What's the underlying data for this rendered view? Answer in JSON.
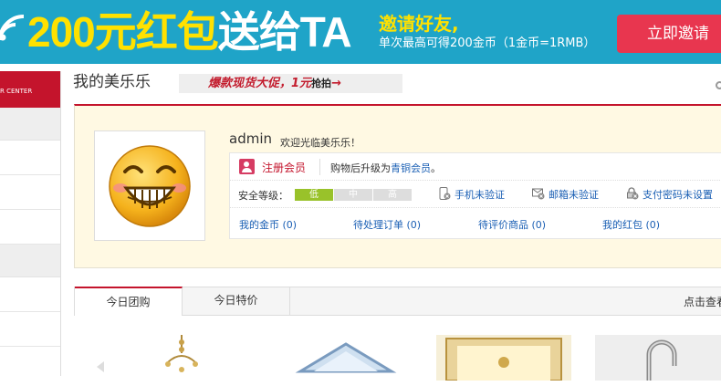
{
  "banner": {
    "amount": "200元",
    "gift": "红包",
    "sendto": "送给TA",
    "invite_friends": "邀请好友,",
    "reward_text": "单次最高可得200金币（1金币=1RMB）",
    "invite_button": "立即邀请"
  },
  "sidebar": {
    "header": "R CENTER"
  },
  "main": {
    "title": "我的美乐乐",
    "promo": "爆款现货大促，",
    "promo_price": "1元",
    "promo_action": "抢拍",
    "promo_arrow": "→"
  },
  "profile": {
    "username": "admin",
    "welcome": "欢迎光临美乐乐！",
    "register_label": "注册会员",
    "upgrade_prefix": "购物后升级为",
    "upgrade_level": "青铜会员",
    "upgrade_suffix": "。",
    "security_label": "安全等级：",
    "security_levels": [
      "低",
      "中",
      "高"
    ],
    "security_current": "低",
    "phone_status": "手机未验证",
    "email_status": "邮箱未验证",
    "paypwd_status": "支付密码未设置",
    "stats": [
      {
        "label": "我的金币",
        "count": "(0)"
      },
      {
        "label": "待处理订单",
        "count": "(0)"
      },
      {
        "label": "待评价商品",
        "count": "(0)"
      },
      {
        "label": "我的红包",
        "count": "(0)"
      }
    ]
  },
  "tabs": {
    "items": [
      "今日团购",
      "今日特价"
    ],
    "active": "今日团购",
    "more": "点击查看"
  },
  "icons": {
    "wifi": "wifi-icon",
    "avatar": "smiley-avatar",
    "register": "user-icon",
    "phone": "phone-icon",
    "email": "mail-icon",
    "paypwd": "lock-icon",
    "scroll": "scroll-knob-icon"
  },
  "colors": {
    "banner_bg": "#1fa4c8",
    "banner_yellow": "#ffe100",
    "invite_button": "#e8364f",
    "brand_red": "#c4142c",
    "link_blue": "#1a5fb4",
    "security_low": "#99c22a",
    "panel_bg": "#fff9e3"
  }
}
